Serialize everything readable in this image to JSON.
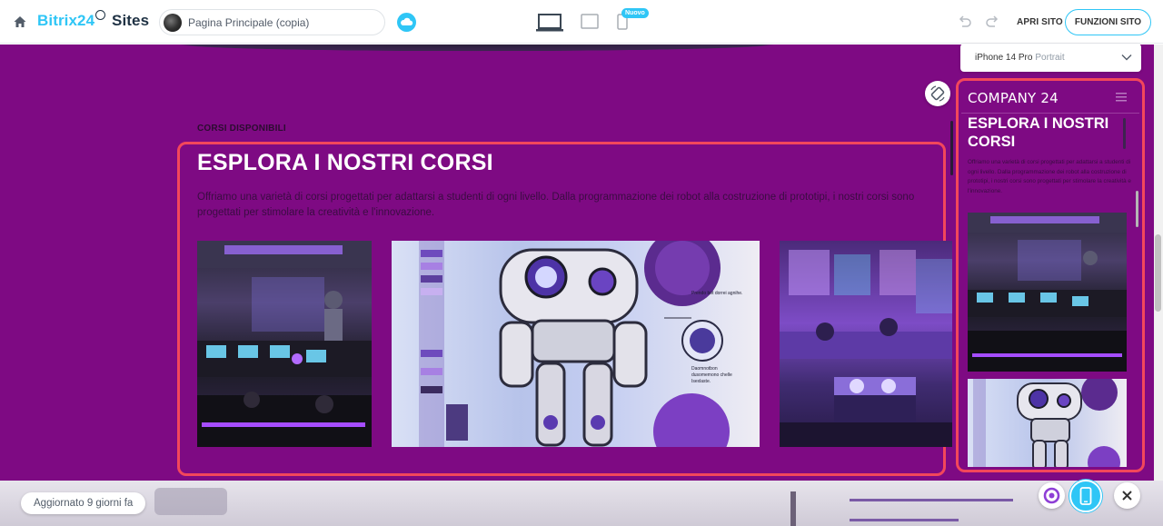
{
  "header": {
    "brand_main": "Bitrix24",
    "brand_sites": "Sites",
    "page_name": "Pagina Principale (copia)",
    "new_badge": "Nuovo",
    "open_site": "APRI SITO",
    "site_functions": "FUNZIONI SITO"
  },
  "section": {
    "label": "CORSI DISPONIBILI",
    "title": "ESPLORA I NOSTRI CORSI",
    "description": "Offriamo una varietà di corsi progettati per adattarsi a studenti di ogni livello. Dalla programmazione dei robot alla costruzione di prototipi, i nostri corsi sono progettati per stimolare la creatività e l'innovazione."
  },
  "preview": {
    "device_name": "iPhone 14 Pro",
    "orientation": "Portrait",
    "company": "COMPANY 24",
    "title": "ESPLORA I NOSTRI CORSI",
    "description": "Offriamo una varietà di corsi progettati per adattarsi a studenti di ogni livello. Dalla programmazione dei robot alla costruzione di prototipi, i nostri corsi sono progettati per stimolare la creatività e l'innovazione."
  },
  "robot_image_text": {
    "annotation_1": "Prendo bot dorrei agnihe.",
    "annotation_2": "Daomnotbon dusomemono chelle Isexlaste."
  },
  "footer": {
    "updated": "Aggiornato 9 giorni fa"
  },
  "colors": {
    "accent": "#2fc6f6",
    "canvas_bg": "#7e0a83",
    "highlight": "#f2475b"
  }
}
